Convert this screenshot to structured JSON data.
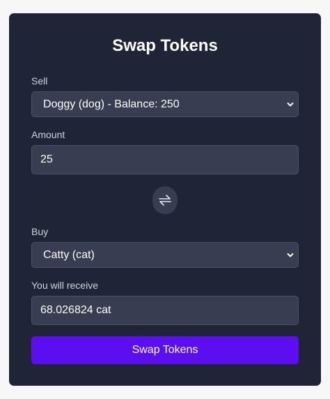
{
  "title": "Swap Tokens",
  "sell": {
    "label": "Sell",
    "selected": "Doggy (dog) - Balance: 250"
  },
  "amount": {
    "label": "Amount",
    "value": "25"
  },
  "swap_direction_icon": "swap-arrows-icon",
  "buy": {
    "label": "Buy",
    "selected": "Catty (cat)"
  },
  "receive": {
    "label": "You will receive",
    "value": "68.026824 cat"
  },
  "submit_label": "Swap Tokens",
  "colors": {
    "card_bg": "#1f2536",
    "field_bg": "#383d52",
    "accent": "#5b0ff0"
  }
}
